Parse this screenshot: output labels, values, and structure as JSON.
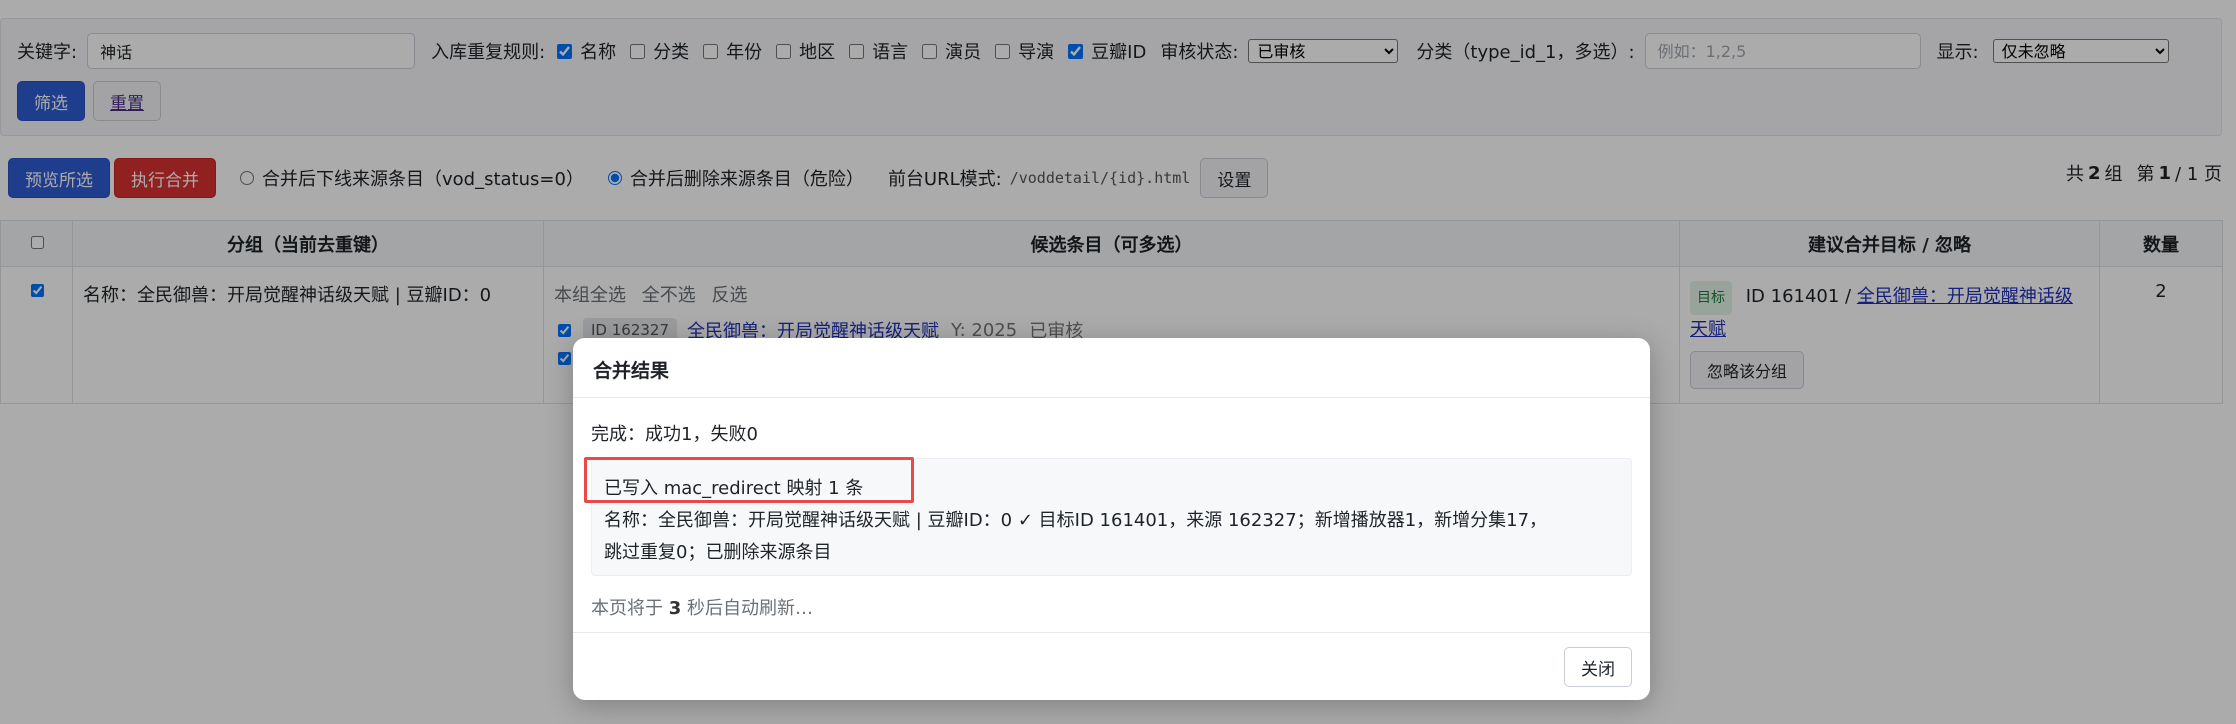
{
  "filter": {
    "keyword_label": "关键字:",
    "keyword_value": "神话",
    "dup_rule_label": "入库重复规则:",
    "dup_options": [
      {
        "label": "名称",
        "checked": true
      },
      {
        "label": "分类",
        "checked": false
      },
      {
        "label": "年份",
        "checked": false
      },
      {
        "label": "地区",
        "checked": false
      },
      {
        "label": "语言",
        "checked": false
      },
      {
        "label": "演员",
        "checked": false
      },
      {
        "label": "导演",
        "checked": false
      },
      {
        "label": "豆瓣ID",
        "checked": true
      }
    ],
    "audit_label": "审核状态:",
    "audit_selected": "已审核",
    "type_label": "分类（type_id_1，多选）:",
    "type_placeholder": "例如：1,2,5",
    "display_label": "显示:",
    "display_selected": "仅未忽略",
    "filter_button": "筛选",
    "reset_button": "重置"
  },
  "actions": {
    "preview_button": "预览所选",
    "merge_button": "执行合并",
    "radio_offline": "合并后下线来源条目（vod_status=0）",
    "radio_delete": "合并后删除来源条目（危险）",
    "radio_selected": "delete",
    "url_mode_label": "前台URL模式:",
    "url_mode_value": "/voddetail/{id}.html",
    "settings_button": "设置",
    "pager_total_pre": "共",
    "pager_total": "2",
    "pager_total_post": "组",
    "pager_page_pre": "第",
    "pager_page": "1",
    "pager_page_post": "/ 1 页"
  },
  "table": {
    "headers": {
      "group": "分组（当前去重键）",
      "candidates": "候选条目（可多选）",
      "target": "建议合并目标 / 忽略",
      "count": "数量"
    },
    "row": {
      "group_text": "名称：全民御兽：开局觉醒神话级天赋 | 豆瓣ID：0",
      "select_all": "本组全选",
      "select_none": "全不选",
      "invert": "反选",
      "candidate_id": "ID 162327",
      "candidate_title": "全民御兽：开局觉醒神话级天赋",
      "candidate_year": "Y: 2025",
      "candidate_status": "已审核",
      "target_tag": "目标",
      "target_id": "ID 161401 /",
      "target_title": "全民御兽：开局觉醒神话级天赋",
      "ignore_button": "忽略该分组",
      "count": "2"
    }
  },
  "modal": {
    "title": "合并结果",
    "summary": "完成：成功1，失败0",
    "redirect_line": "已写入 mac_redirect 映射 1 条",
    "detail_line1": "名称：全民御兽：开局觉醒神话级天赋 | 豆瓣ID：0 ✓ 目标ID 161401，来源 162327；新增播放器1，新增分集17，",
    "detail_line2": "跳过重复0；已删除来源条目",
    "refresh_pre": "本页将于",
    "refresh_seconds": "3",
    "refresh_post": "秒后自动刷新…",
    "close_button": "关闭"
  },
  "colors": {
    "primary": "#2f5bd2",
    "danger": "#d93030",
    "highlight": "#e84a4a",
    "link": "#2130b8"
  }
}
